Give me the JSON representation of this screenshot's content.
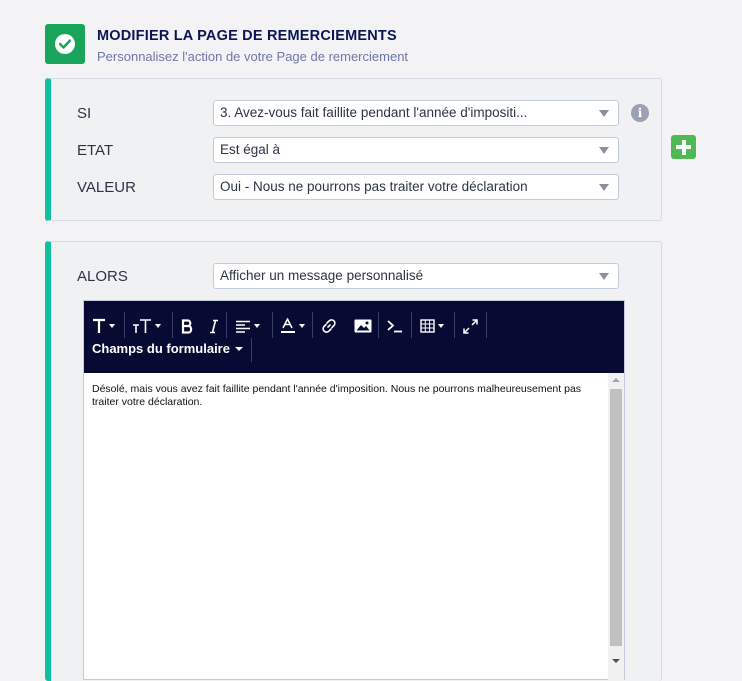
{
  "header": {
    "title": "MODIFIER LA PAGE DE REMERCIEMENTS",
    "subtitle": "Personnalisez l'action de votre Page de remerciement"
  },
  "condition": {
    "if_label": "SI",
    "if_value": "3. Avez-vous fait faillite pendant l'année d'impositi...",
    "state_label": "ETAT",
    "state_value": "Est égal à",
    "value_label": "VALEUR",
    "value_value": "Oui - Nous ne pourrons pas traiter votre déclaration"
  },
  "action": {
    "then_label": "ALORS",
    "then_value": "Afficher un message personnalisé"
  },
  "editor": {
    "form_fields_label": "Champs du formulaire",
    "content": "Désolé, mais vous avez fait faillite pendant l'année d'imposition. Nous ne pourrons malheureusement pas traiter votre déclaration."
  },
  "colors": {
    "accent": "#0fbf9f",
    "check_green": "#18a55b",
    "add_green": "#4fb954",
    "toolbar_bg": "#070b33",
    "title": "#0a1551"
  },
  "icons": [
    "check-icon",
    "info-icon",
    "plus-icon",
    "font-family-icon",
    "font-size-icon",
    "bold-icon",
    "italic-icon",
    "align-icon",
    "text-color-icon",
    "link-icon",
    "image-icon",
    "code-icon",
    "table-icon",
    "fullscreen-icon"
  ]
}
